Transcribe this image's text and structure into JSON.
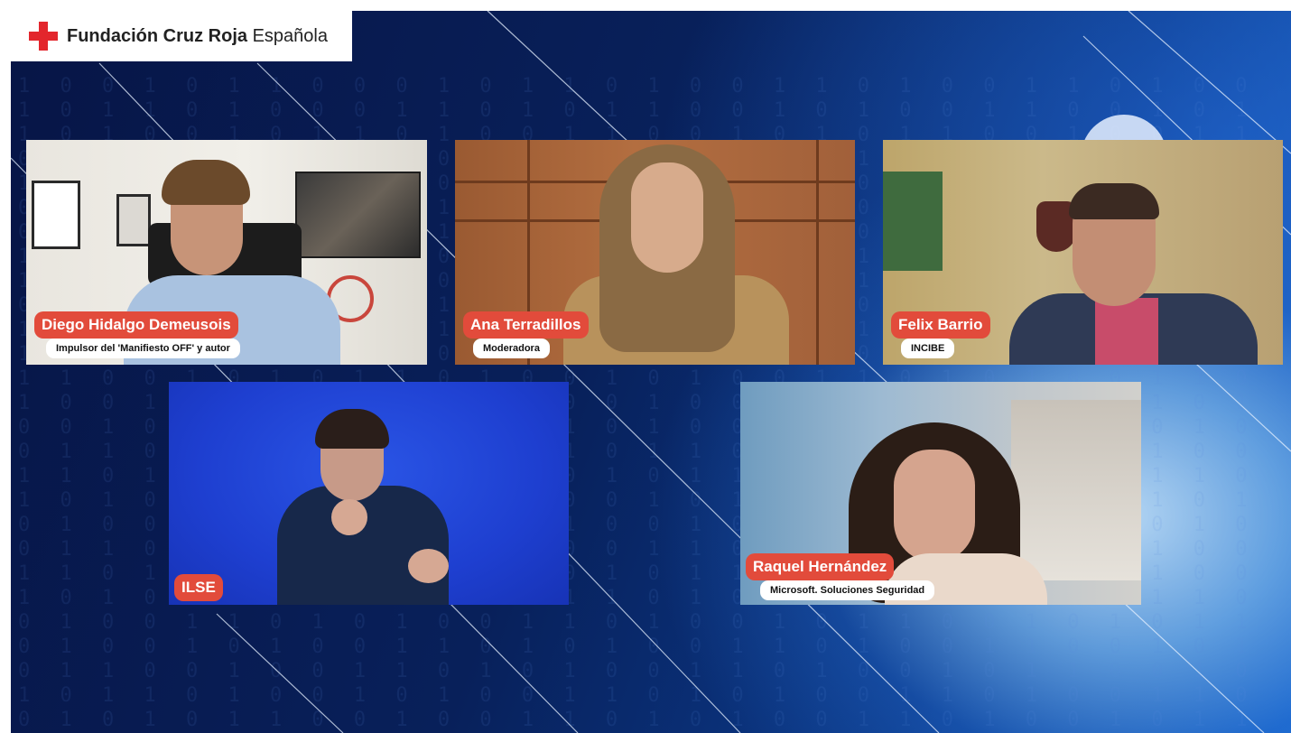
{
  "brand": {
    "name_bold": "Fundación Cruz Roja",
    "name_regular": "Española",
    "color": "#e3262c"
  },
  "participants": [
    {
      "name": "Diego Hidalgo Demeusois",
      "role": "Impulsor del 'Manifiesto OFF' y autor"
    },
    {
      "name": "Ana Terradillos",
      "role": "Moderadora"
    },
    {
      "name": "Felix Barrio",
      "role": "INCIBE"
    },
    {
      "name": "ILSE",
      "role": ""
    },
    {
      "name": "Raquel Hernández",
      "role": "Microsoft. Soluciones Seguridad"
    }
  ],
  "colors": {
    "name_tag": "#e24b3b",
    "background": "#08205a",
    "sign_tile": "#2046d8"
  },
  "icons": {
    "brand_logo": "red-cross-icon"
  }
}
